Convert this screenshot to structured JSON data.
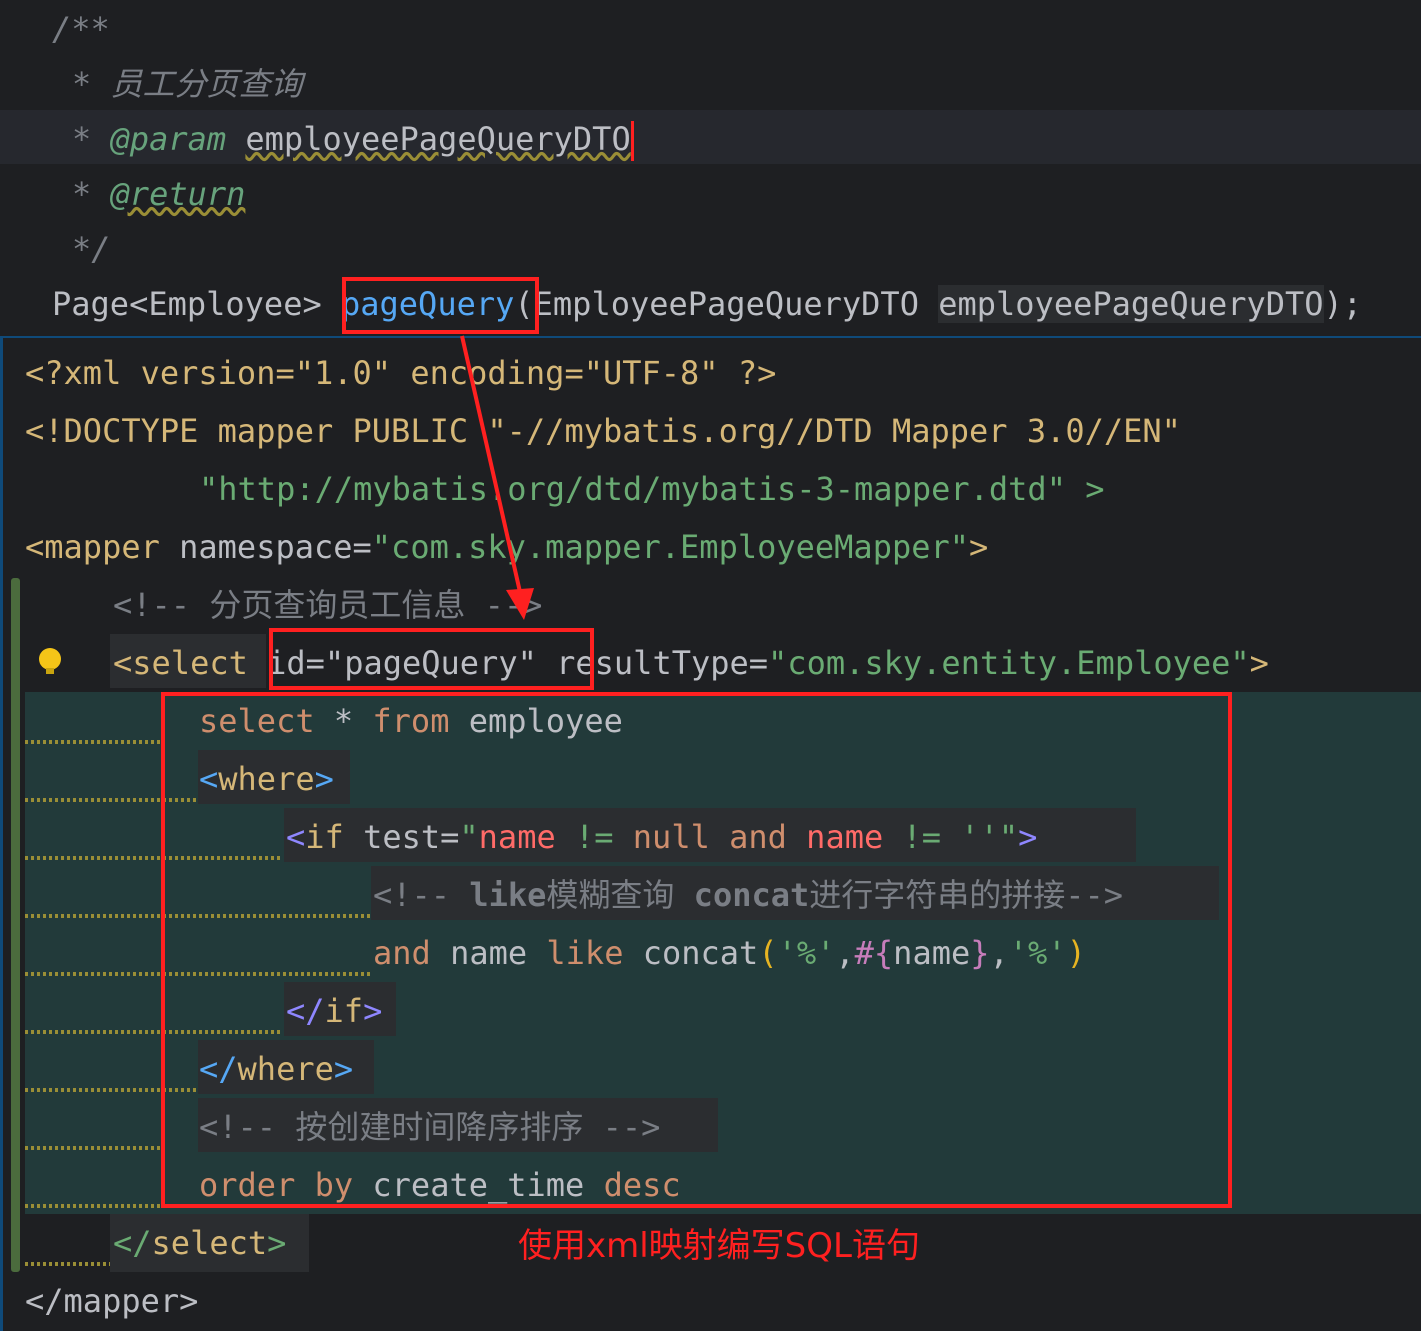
{
  "java_comment": {
    "open": "/**",
    "desc": "* 员工分页查询",
    "param_star": "*",
    "param_tag": "@param",
    "param_name": "employeePageQueryDTO",
    "return_star": "*",
    "return_tag": "@return",
    "close": "*/"
  },
  "method_signature": {
    "return_type": "Page<Employee>",
    "method_name": "pageQuery",
    "open_paren": "(",
    "param_type": "EmployeePageQueryDTO",
    "param_name": "employeePageQueryDTO",
    "close": ");"
  },
  "xml": {
    "line1": "<?xml version=\"1.0\" encoding=\"UTF-8\" ?>",
    "line2": "<!DOCTYPE mapper PUBLIC \"-//mybatis.org//DTD Mapper 3.0//EN\"",
    "line3": "\"http://mybatis.org/dtd/mybatis-3-mapper.dtd\" >",
    "line4a": "<mapper ",
    "line4b": "namespace=",
    "line4c": "\"com.sky.mapper.EmployeeMapper\"",
    "line4d": ">",
    "line5": "<!-- 分页查询员工信息 -->",
    "select_open": "<select",
    "select_id": "id=\"pageQuery\"",
    "select_rt_attr": "resultType=",
    "select_rt_val": "\"com.sky.entity.Employee\"",
    "select_close_angle": ">",
    "sql1_kw1": "select",
    "sql1_star": " * ",
    "sql1_kw2": "from",
    "sql1_tbl": " employee",
    "where_open_lt": "<",
    "where_open_name": "where",
    "where_open_gt": ">",
    "if_lt": "<",
    "if_name": "if",
    "if_attr": " test=",
    "if_q": "\"",
    "if_v1": "name",
    "if_op1": " != ",
    "if_v2": "null",
    "if_and": " and ",
    "if_v3": "name",
    "if_op2": " != ",
    "if_v4": "''",
    "if_q2": "\"",
    "if_gt": ">",
    "like_comment_a": "<!-- ",
    "like_comment_b": "like",
    "like_comment_c": "模糊查询 ",
    "like_comment_d": "concat",
    "like_comment_e": "进行字符串的拼接-->",
    "cond_and": "and",
    "cond_name": " name ",
    "cond_like": "like",
    "cond_concat": " concat",
    "cond_paren": "(",
    "cond_pct1": "'%'",
    "cond_comma1": ",",
    "cond_hash": "#{",
    "cond_var": "name",
    "cond_hash_close": "}",
    "cond_comma2": ",",
    "cond_pct2": "'%'",
    "cond_paren2": ")",
    "if_close_lt": "</",
    "if_close_name": "if",
    "if_close_gt": ">",
    "where_close_lt": "</",
    "where_close_name": "where",
    "where_close_gt": ">",
    "order_comment": "<!-- 按创建时间降序排序 -->",
    "order_kw1": "order",
    "order_kw2": " by",
    "order_col": " create_time ",
    "order_kw3": "desc",
    "select_end_lt": "</",
    "select_end_name": "select",
    "select_end_gt": ">",
    "mapper_end": "</mapper>"
  },
  "annotation": "使用xml映射编写SQL语句",
  "colors": {
    "background": "#1e1f22",
    "annotation_red": "#ff2020",
    "string_green": "#6aab73",
    "keyword_orange": "#cf8e6d",
    "method_blue": "#56a8f5"
  },
  "icons": [
    "lightbulb-icon",
    "arrow-annotation"
  ]
}
